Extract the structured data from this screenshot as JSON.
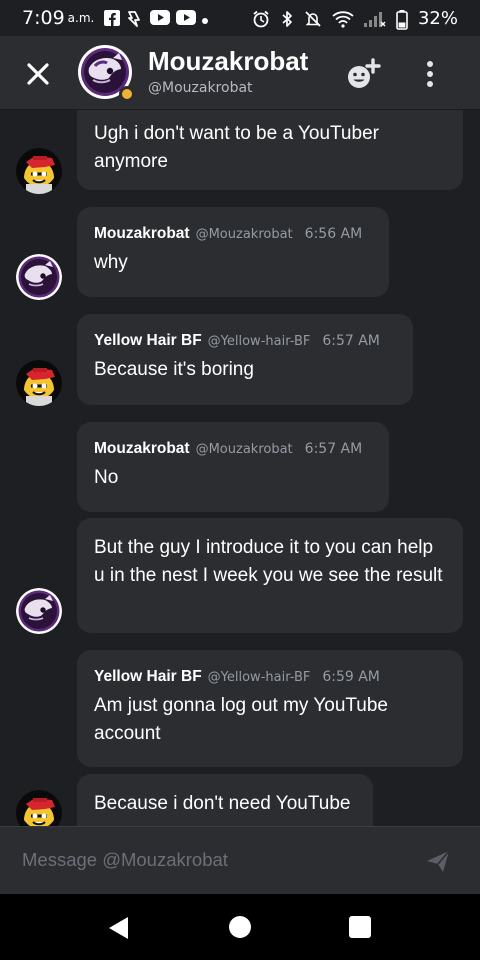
{
  "status_bar": {
    "time": "7:09",
    "ampm": "a.m.",
    "battery_percent": "32%",
    "left_icons": [
      "facebook-icon",
      "flash-icon",
      "youtube-icon",
      "youtube-icon",
      "dot-icon"
    ],
    "right_icons": [
      "alarm-icon",
      "bluetooth-icon",
      "mute-icon",
      "wifi-icon",
      "signal-icon",
      "battery-icon"
    ]
  },
  "header": {
    "name": "Mouzakrobat",
    "handle": "@Mouzakrobat",
    "presence": "idle"
  },
  "messages": [
    {
      "author": "",
      "handle": "",
      "time": "",
      "text": "Ugh i don't want to be a YouTuber anymore",
      "avatar": "yellow-hair-bf"
    },
    {
      "author": "Mouzakrobat",
      "handle": "@Mouzakrobat",
      "time": "6:56 AM",
      "text": "why",
      "avatar": "mouzakrobat"
    },
    {
      "author": "Yellow Hair BF",
      "handle": "@Yellow-hair-BF",
      "time": "6:57 AM",
      "text": "Because it's boring",
      "avatar": "yellow-hair-bf"
    },
    {
      "author": "Mouzakrobat",
      "handle": "@Mouzakrobat",
      "time": "6:57 AM",
      "text": "No",
      "avatar": ""
    },
    {
      "author": "",
      "handle": "",
      "time": "",
      "text": "But the guy I introduce it to you can help u in the nest I week you we see the result",
      "avatar": "mouzakrobat"
    },
    {
      "author": "Yellow Hair BF",
      "handle": "@Yellow-hair-BF",
      "time": "6:59 AM",
      "text": "Am just gonna log out my YouTube account",
      "avatar": ""
    },
    {
      "author": "",
      "handle": "",
      "time": "",
      "text": "Because i don't need YouTube",
      "avatar": "yellow-hair-bf"
    }
  ],
  "composer": {
    "placeholder": "Message @Mouzakrobat"
  },
  "colors": {
    "background": "#1e1f22",
    "bubble": "#2b2d31",
    "idle_status": "#f0b232",
    "muted_text": "#949ba4"
  }
}
